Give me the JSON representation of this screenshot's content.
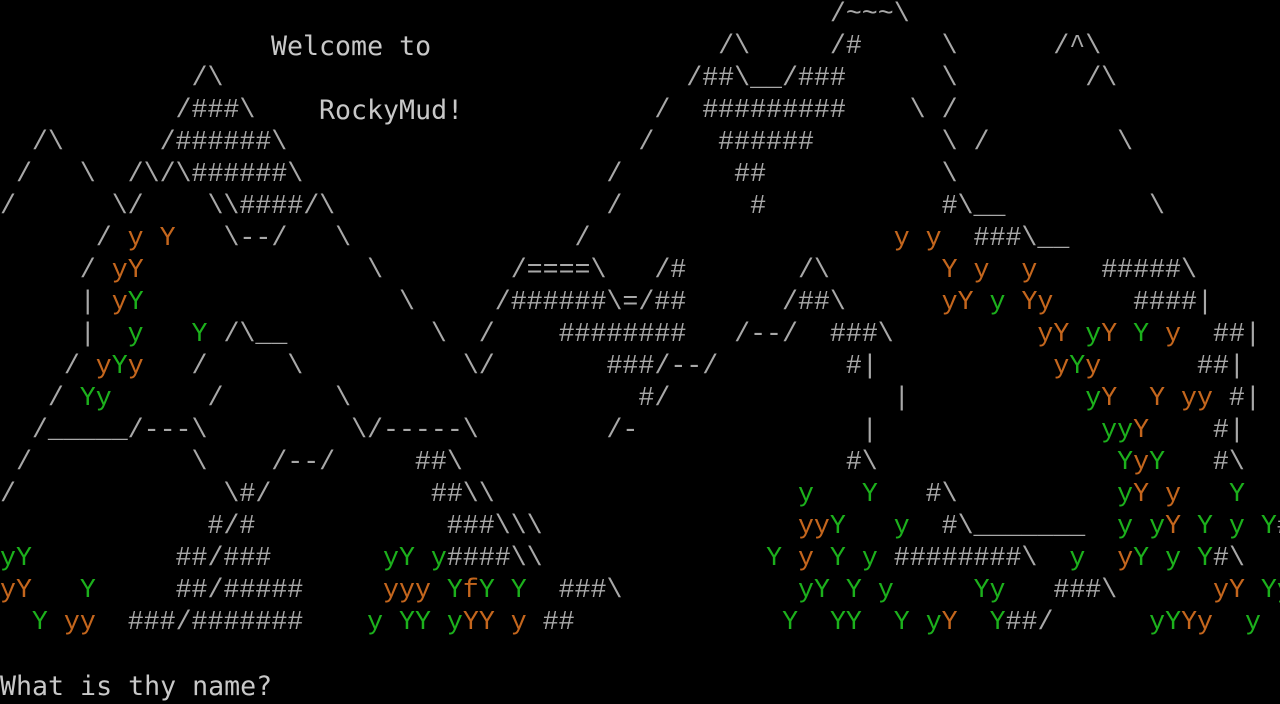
{
  "banner": {
    "line1": "Welcome to",
    "line2": "RockyMud!"
  },
  "prompt": {
    "text": "What is thy name?"
  },
  "colors": {
    "background": "#000000",
    "rock": "#a8a8a8",
    "tree_orange": "#c4661d",
    "tree_green": "#1cb01c"
  },
  "art": {
    "rows": [
      [
        [
          "w",
          "                                                    /~~~\\"
        ]
      ],
      [
        [
          "w",
          "                                             /\\     /#     \\      /^\\"
        ]
      ],
      [
        [
          "w",
          "            /\\                             /##\\__/###      \\        /\\"
        ]
      ],
      [
        [
          "w",
          "           /###\\                         /  #########    \\ /       "
        ]
      ],
      [
        [
          "w",
          "  /\\      /######\\                      /    ######        \\ /        \\"
        ]
      ],
      [
        [
          "w",
          " /   \\  /\\/\\######\\                   /       ##           \\"
        ]
      ],
      [
        [
          "w",
          "/      \\/    \\\\####/\\                 /        #           #\\__         \\"
        ]
      ],
      [
        [
          "w",
          "      / "
        ],
        [
          "o",
          "y Y"
        ],
        [
          "w",
          "   \\--/   \\              /                   "
        ],
        [
          "o",
          "y y"
        ],
        [
          "w",
          "  ###\\__"
        ]
      ],
      [
        [
          "w",
          "     / "
        ],
        [
          "o",
          "y"
        ],
        [
          "o",
          "Y"
        ],
        [
          "w",
          "              \\        /====\\   /#       /\\       "
        ],
        [
          "o",
          "Y y  y"
        ],
        [
          "w",
          "    #####\\"
        ]
      ],
      [
        [
          "w",
          "     | "
        ],
        [
          "o",
          "y"
        ],
        [
          "g",
          "Y"
        ],
        [
          "w",
          "                \\     /######\\=/##      /##\\      "
        ],
        [
          "o",
          "y"
        ],
        [
          "o",
          "Y"
        ],
        [
          "g",
          " y "
        ],
        [
          "o",
          "Y"
        ],
        [
          "o",
          "y"
        ],
        [
          "w",
          "     ####|"
        ]
      ],
      [
        [
          "w",
          "     |  "
        ],
        [
          "g",
          "y"
        ],
        [
          "w",
          "   "
        ],
        [
          "g",
          "Y"
        ],
        [
          "w",
          " /\\__         \\  /    ########   /--/  ###\\         "
        ],
        [
          "o",
          "y"
        ],
        [
          "o",
          "Y"
        ],
        [
          "g",
          " y"
        ],
        [
          "o",
          "Y"
        ],
        [
          "g",
          " Y"
        ],
        [
          "o",
          " y"
        ],
        [
          "w",
          "  ##|"
        ]
      ],
      [
        [
          "w",
          "    / "
        ],
        [
          "o",
          "y"
        ],
        [
          "g",
          "Y"
        ],
        [
          "o",
          "y"
        ],
        [
          "w",
          "   /     \\          \\/       ###/--/        #|           "
        ],
        [
          "o",
          "y"
        ],
        [
          "g",
          "Y"
        ],
        [
          "o",
          "y"
        ],
        [
          "w",
          "      ##|"
        ]
      ],
      [
        [
          "w",
          "   / "
        ],
        [
          "g",
          "Yy"
        ],
        [
          "w",
          "      /       \\                  #/              |           "
        ],
        [
          "g",
          "y"
        ],
        [
          "o",
          "Y"
        ],
        [
          "w",
          "  "
        ],
        [
          "o",
          "Y yy"
        ],
        [
          "w",
          " #|"
        ]
      ],
      [
        [
          "w",
          "  /_____/---\\         \\/-----\\        /-              |              "
        ],
        [
          "g",
          "yy"
        ],
        [
          "o",
          "Y"
        ],
        [
          "w",
          "    #|"
        ]
      ],
      [
        [
          "w",
          " /          \\    /--/     ##\\                        #\\               "
        ],
        [
          "g",
          "Y"
        ],
        [
          "o",
          "y"
        ],
        [
          "g",
          "Y"
        ],
        [
          "w",
          "   #\\"
        ]
      ],
      [
        [
          "w",
          "/             \\#/          ##\\\\                   "
        ],
        [
          "g",
          "y"
        ],
        [
          "w",
          "   "
        ],
        [
          "g",
          "Y"
        ],
        [
          "w",
          "   #\\          "
        ],
        [
          "g",
          "y"
        ],
        [
          "o",
          "Y"
        ],
        [
          "w",
          " "
        ],
        [
          "o",
          "y"
        ],
        [
          "w",
          "   "
        ],
        [
          "g",
          "Y"
        ],
        [
          "w",
          "   #\\"
        ]
      ],
      [
        [
          "w",
          "             #/#            ###\\\\\\                "
        ],
        [
          "o",
          "yy"
        ],
        [
          "g",
          "Y"
        ],
        [
          "w",
          "   "
        ],
        [
          "g",
          "y"
        ],
        [
          "w",
          "  #\\_______  "
        ],
        [
          "g",
          "y y"
        ],
        [
          "o",
          "Y"
        ],
        [
          "w",
          " "
        ],
        [
          "g",
          "Y y"
        ],
        [
          "w",
          " "
        ],
        [
          "g",
          "Y"
        ],
        [
          "w",
          "#\\"
        ]
      ],
      [
        [
          "g",
          "yY"
        ],
        [
          "w",
          "         ##/###       "
        ],
        [
          "g",
          "yY y"
        ],
        [
          "w",
          "####\\\\              "
        ],
        [
          "g",
          "Y "
        ],
        [
          "o",
          "y"
        ],
        [
          "g",
          " Y y"
        ],
        [
          "w",
          " ########\\  "
        ],
        [
          "g",
          "y"
        ],
        [
          "w",
          "  "
        ],
        [
          "o",
          "y"
        ],
        [
          "g",
          "Y y"
        ],
        [
          "w",
          " "
        ],
        [
          "g",
          "Y"
        ],
        [
          "w",
          "#\\"
        ]
      ],
      [
        [
          "o",
          "yY"
        ],
        [
          "w",
          "   "
        ],
        [
          "g",
          "Y"
        ],
        [
          "w",
          "     ##/#####     "
        ],
        [
          "o",
          "yyy"
        ],
        [
          "g",
          " Y"
        ],
        [
          "o",
          "f"
        ],
        [
          "g",
          "Y Y"
        ],
        [
          "w",
          "  ###\\           "
        ],
        [
          "g",
          "yY Y y"
        ],
        [
          "w",
          "     "
        ],
        [
          "g",
          "Yy"
        ],
        [
          "w",
          "   ###\\      "
        ],
        [
          "o",
          "yY"
        ],
        [
          "g",
          " Yy"
        ]
      ],
      [
        [
          "w",
          "  "
        ],
        [
          "g",
          "Y"
        ],
        [
          "w",
          " "
        ],
        [
          "o",
          "yy"
        ],
        [
          "w",
          "  ###/#######    "
        ],
        [
          "g",
          "y YY y"
        ],
        [
          "o",
          "YY"
        ],
        [
          "w",
          " "
        ],
        [
          "o",
          "y"
        ],
        [
          "w",
          " ##             "
        ],
        [
          "g",
          "Y  YY  Y"
        ],
        [
          "w",
          " "
        ],
        [
          "g",
          "y"
        ],
        [
          "o",
          "Y"
        ],
        [
          "w",
          "  "
        ],
        [
          "g",
          "Y"
        ],
        [
          "w",
          "##/      "
        ],
        [
          "g",
          "yY"
        ],
        [
          "o",
          "Yy"
        ],
        [
          "w",
          "  "
        ],
        [
          "g",
          "y"
        ]
      ]
    ]
  }
}
